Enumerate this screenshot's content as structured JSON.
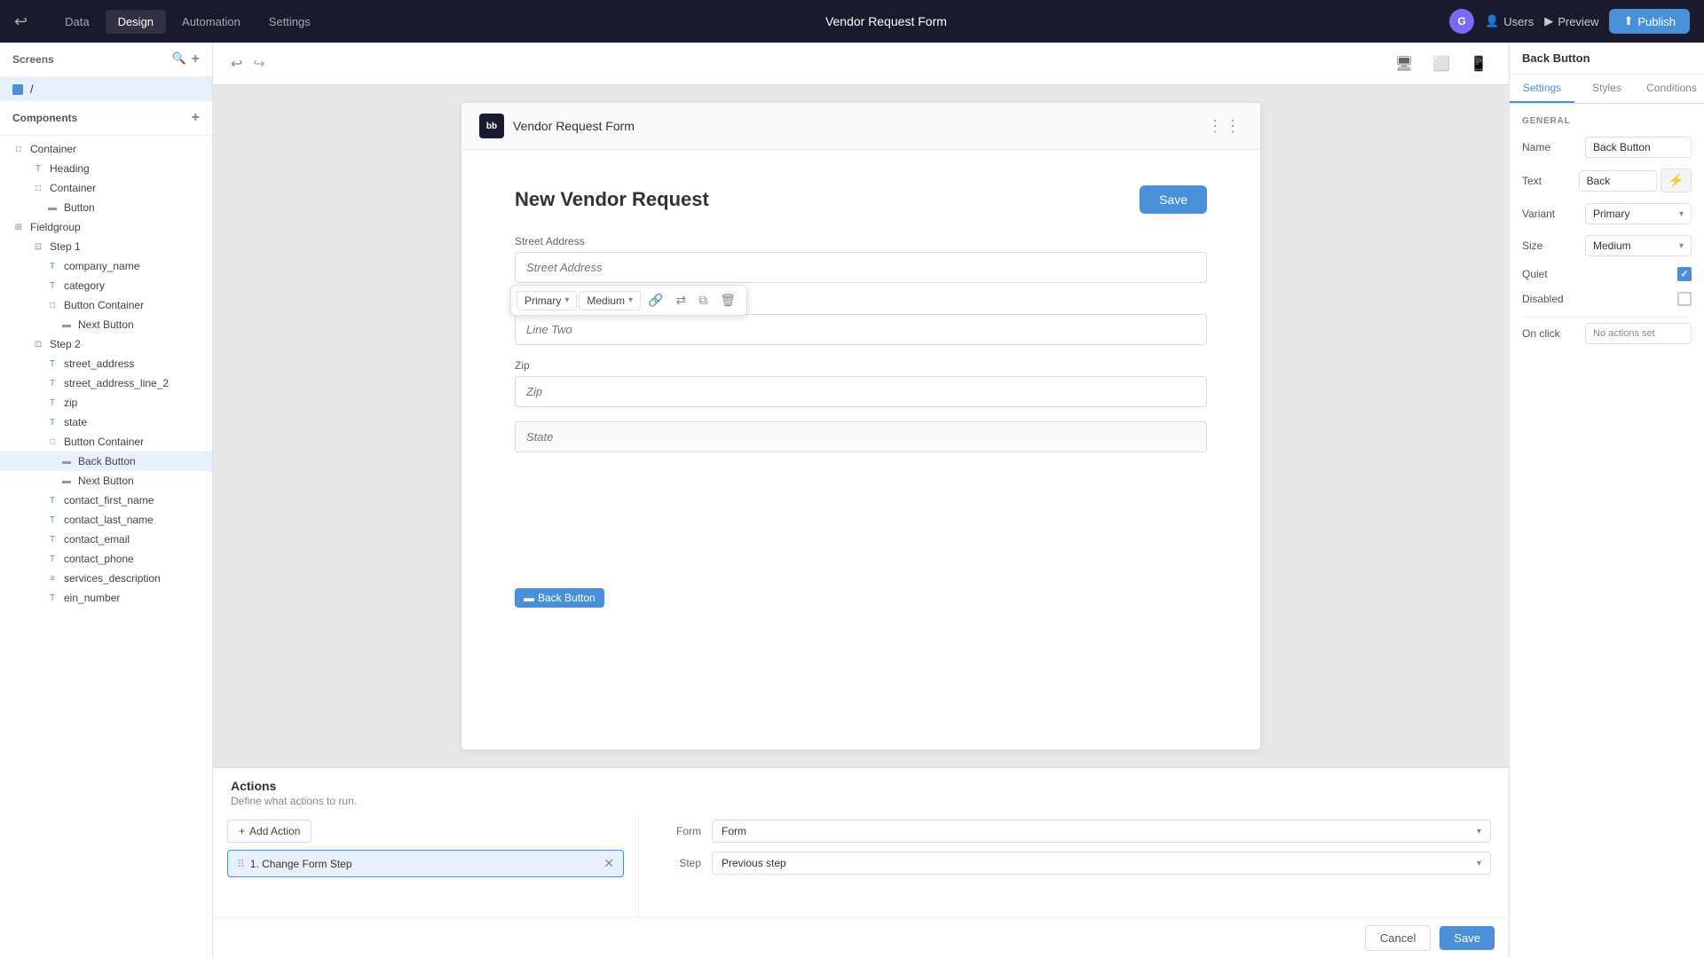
{
  "topNav": {
    "backIcon": "←",
    "tabs": [
      {
        "label": "Data",
        "active": false
      },
      {
        "label": "Design",
        "active": true
      },
      {
        "label": "Automation",
        "active": false
      },
      {
        "label": "Settings",
        "active": false
      }
    ],
    "pageTitle": "Vendor Request Form",
    "avatar": "G",
    "usersLabel": "Users",
    "previewLabel": "Preview",
    "publishLabel": "Publish"
  },
  "leftPanel": {
    "screensLabel": "Screens",
    "screensItem": "/",
    "componentsLabel": "Components",
    "tree": [
      {
        "label": "Container",
        "indent": 0,
        "icon": "□"
      },
      {
        "label": "Heading",
        "indent": 1,
        "icon": "T"
      },
      {
        "label": "Container",
        "indent": 1,
        "icon": "□"
      },
      {
        "label": "Button",
        "indent": 2,
        "icon": "▬"
      },
      {
        "label": "Fieldgroup",
        "indent": 0,
        "icon": "⊞"
      },
      {
        "label": "Step 1",
        "indent": 1,
        "icon": "⊡"
      },
      {
        "label": "company_name",
        "indent": 2,
        "icon": "T"
      },
      {
        "label": "category",
        "indent": 2,
        "icon": "T"
      },
      {
        "label": "Button Container",
        "indent": 2,
        "icon": "□"
      },
      {
        "label": "Next Button",
        "indent": 3,
        "icon": "▬"
      },
      {
        "label": "Step 2",
        "indent": 1,
        "icon": "⊡"
      },
      {
        "label": "street_address",
        "indent": 2,
        "icon": "T"
      },
      {
        "label": "street_address_line_2",
        "indent": 2,
        "icon": "T"
      },
      {
        "label": "zip",
        "indent": 2,
        "icon": "T"
      },
      {
        "label": "state",
        "indent": 2,
        "icon": "T"
      },
      {
        "label": "Button Container",
        "indent": 2,
        "icon": "□"
      },
      {
        "label": "Back Button",
        "indent": 3,
        "icon": "▬",
        "selected": true
      },
      {
        "label": "Next Button",
        "indent": 3,
        "icon": "▬"
      },
      {
        "label": "contact_first_name",
        "indent": 2,
        "icon": "T"
      },
      {
        "label": "contact_last_name",
        "indent": 2,
        "icon": "T"
      },
      {
        "label": "contact_email",
        "indent": 2,
        "icon": "T"
      },
      {
        "label": "contact_phone",
        "indent": 2,
        "icon": "T"
      },
      {
        "label": "services_description",
        "indent": 2,
        "icon": "≡"
      },
      {
        "label": "ein_number",
        "indent": 2,
        "icon": "T"
      }
    ]
  },
  "toolbar": {
    "undoIcon": "↩",
    "redoIcon": "↪",
    "desktopIcon": "🖥",
    "tabletIcon": "📱",
    "mobileIcon": "📱"
  },
  "formCanvas": {
    "logoText": "bb",
    "formTitleBar": "Vendor Request Form",
    "dotsIcon": "⋮⋮",
    "heading": "New Vendor Request",
    "saveLabel": "Save",
    "fields": [
      {
        "label": "Street Address",
        "placeholder": "Street Address"
      },
      {
        "label": "Line Two",
        "placeholder": "Line Two"
      },
      {
        "label": "Zip",
        "placeholder": "Zip"
      },
      {
        "label": "",
        "placeholder": "State"
      }
    ],
    "floatingToolbar": {
      "primaryLabel": "Primary",
      "mediumLabel": "Medium"
    },
    "backButtonChip": "Back Button"
  },
  "actionsPanel": {
    "title": "Actions",
    "subtitle": "Define what actions to run.",
    "addActionLabel": "Add Action",
    "cancelLabel": "Cancel",
    "saveLabel": "Save",
    "actionItem": "1. Change Form Step",
    "formDropdown": "Form",
    "stepDropdown": "Previous step",
    "formLabel": "Form",
    "stepLabel": "Step"
  },
  "rightPanel": {
    "title": "Back Button",
    "tabs": [
      "Settings",
      "Styles",
      "Conditions"
    ],
    "activeTab": "Settings",
    "generalLabel": "GENERAL",
    "nameLabel": "Name",
    "nameValue": "Back Button",
    "textLabel": "Text",
    "textValue": "Back",
    "variantLabel": "Variant",
    "variantValue": "Primary",
    "sizeLabel": "Size",
    "sizeValue": "Medium",
    "quietLabel": "Quiet",
    "disabledLabel": "Disabled",
    "onClickLabel": "On click",
    "onClickValue": "No actions set",
    "lightningIcon": "⚡"
  }
}
